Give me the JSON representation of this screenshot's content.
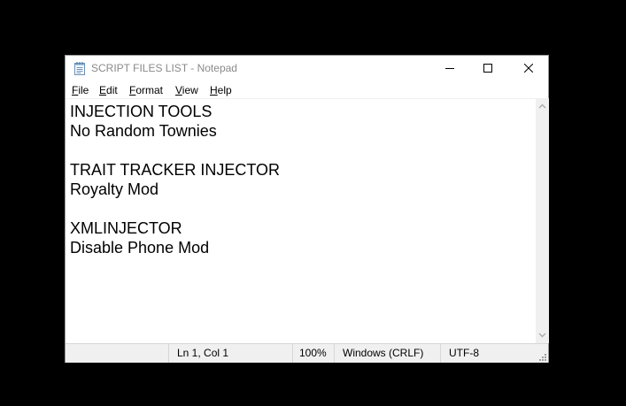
{
  "window": {
    "title": "SCRIPT FILES LIST - Notepad",
    "icon": "notepad-icon",
    "controls": [
      "minimize-icon",
      "maximize-icon",
      "close-icon"
    ]
  },
  "menu": {
    "file": {
      "hotkey": "F",
      "rest": "ile"
    },
    "edit": {
      "hotkey": "E",
      "rest": "dit"
    },
    "format": {
      "hotkey": "F",
      "rest": "ormat"
    },
    "view": {
      "hotkey": "V",
      "rest": "iew"
    },
    "help": {
      "hotkey": "H",
      "rest": "elp"
    }
  },
  "editor": {
    "lines": [
      "INJECTION TOOLS",
      "No Random Townies",
      "",
      "TRAIT TRACKER INJECTOR",
      "Royalty Mod",
      "",
      "XMLINJECTOR",
      "Disable Phone Mod"
    ]
  },
  "status": {
    "position": "Ln 1, Col 1",
    "zoom": "100%",
    "line_ending": "Windows (CRLF)",
    "encoding": "UTF-8"
  },
  "colors": {
    "background": "#000000",
    "title_text": "#8a8a8a",
    "statusbar": "#f0f0f0"
  }
}
